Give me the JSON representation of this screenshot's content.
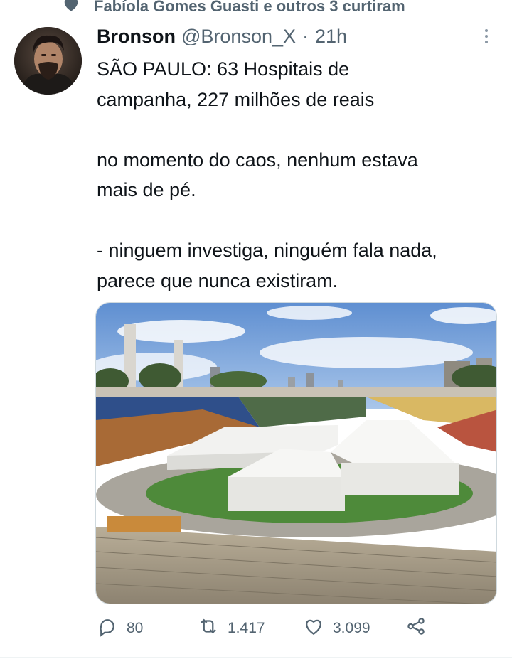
{
  "social_context": {
    "text": "Fabíola Gomes Guasti e outros 3 curtiram",
    "icon": "heart-icon"
  },
  "tweet": {
    "author_name": "Bronson",
    "author_handle": "@Bronson_X",
    "separator": "·",
    "time": "21h",
    "text_lines": [
      "SÃO PAULO: 63 Hospitais de",
      "campanha, 227 milhões de reais",
      "no momento do caos, nenhum estava",
      "mais de pé.",
      "- ninguem investiga, ninguém fala nada,",
      "parece que nunca existiram."
    ],
    "media_description": "photo"
  },
  "actions": {
    "replies": "80",
    "retweets": "1.417",
    "likes": "3.099",
    "reply_icon": "reply-icon",
    "retweet_icon": "retweet-icon",
    "like_icon": "heart-icon",
    "share_icon": "share-icon"
  },
  "colors": {
    "text_primary": "#0f1419",
    "text_secondary": "#536471",
    "divider": "#eff3f4"
  }
}
